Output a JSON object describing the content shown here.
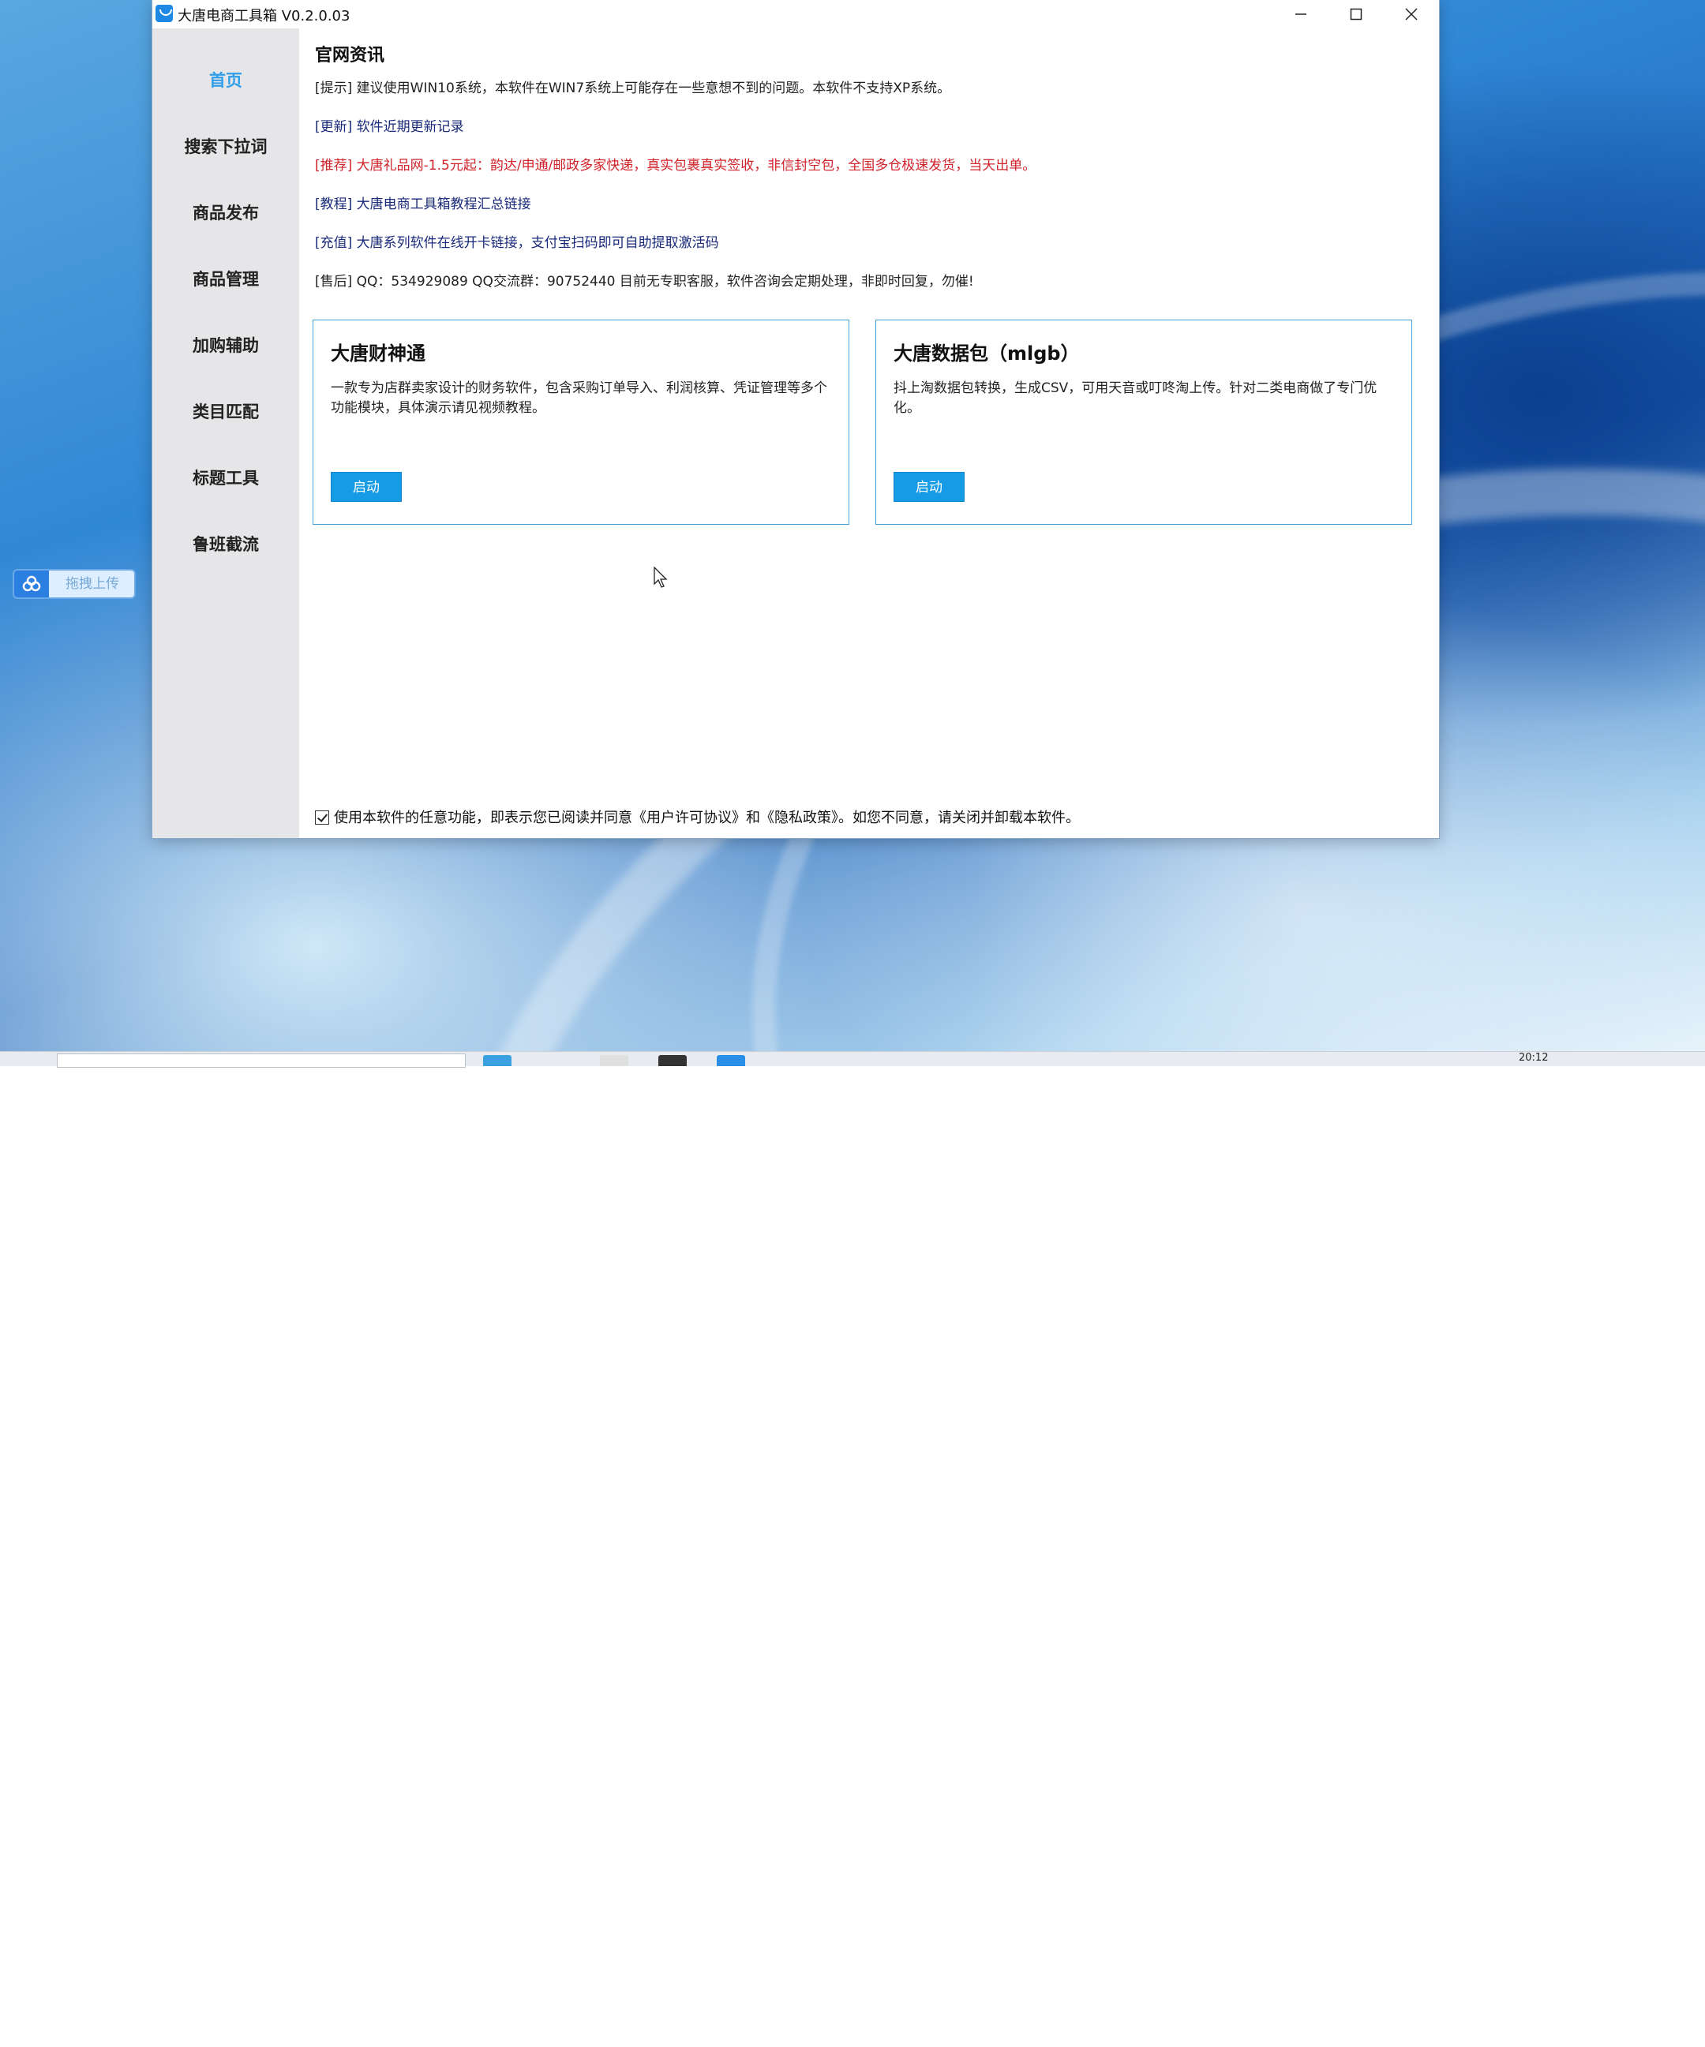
{
  "window": {
    "title": "大唐电商工具箱 V0.2.0.03"
  },
  "sidebar": {
    "items": [
      {
        "label": "首页",
        "active": true
      },
      {
        "label": "搜索下拉词",
        "active": false
      },
      {
        "label": "商品发布",
        "active": false
      },
      {
        "label": "商品管理",
        "active": false
      },
      {
        "label": "加购辅助",
        "active": false
      },
      {
        "label": "类目匹配",
        "active": false
      },
      {
        "label": "标题工具",
        "active": false
      },
      {
        "label": "鲁班截流",
        "active": false
      }
    ]
  },
  "main": {
    "section_title": "官网资讯",
    "news": [
      {
        "text": "[提示] 建议使用WIN10系统，本软件在WIN7系统上可能存在一些意想不到的问题。本软件不支持XP系统。",
        "style": "tip"
      },
      {
        "text": "[更新] 软件近期更新记录",
        "style": "link"
      },
      {
        "text": "[推荐] 大唐礼品网-1.5元起：韵达/申通/邮政多家快递，真实包裹真实签收，非信封空包，全国多仓极速发货，当天出单。",
        "style": "red"
      },
      {
        "text": "[教程] 大唐电商工具箱教程汇总链接",
        "style": "link"
      },
      {
        "text": "[充值] 大唐系列软件在线开卡链接，支付宝扫码即可自助提取激活码",
        "style": "link"
      },
      {
        "text": "[售后] QQ：534929089 QQ交流群：90752440 目前无专职客服，软件咨询会定期处理，非即时回复，勿催!",
        "style": "tip"
      }
    ],
    "cards": [
      {
        "title": "大唐财神通",
        "desc": "一款专为店群卖家设计的财务软件，包含采购订单导入、利润核算、凭证管理等多个功能模块，具体演示请见视频教程。",
        "button": "启动"
      },
      {
        "title": "大唐数据包（mlgb）",
        "desc": "抖上淘数据包转换，生成CSV，可用天音或叮咚淘上传。针对二类电商做了专门优化。",
        "button": "启动"
      }
    ],
    "agreement": {
      "checked": true,
      "text": "使用本软件的任意功能，即表示您已阅读并同意《用户许可协议》和《隐私政策》。如您不同意，请关闭并卸载本软件。"
    }
  },
  "desktop_widget": {
    "label": "拖拽上传"
  },
  "taskbar": {
    "clock": "20:12"
  },
  "colors": {
    "accent": "#169be6",
    "active_nav": "#2f9ee8",
    "sidebar_bg": "#e6e6e9",
    "card_border": "#4aa3d8",
    "red_text": "#d0232a",
    "link_text": "#1a2a7a"
  }
}
